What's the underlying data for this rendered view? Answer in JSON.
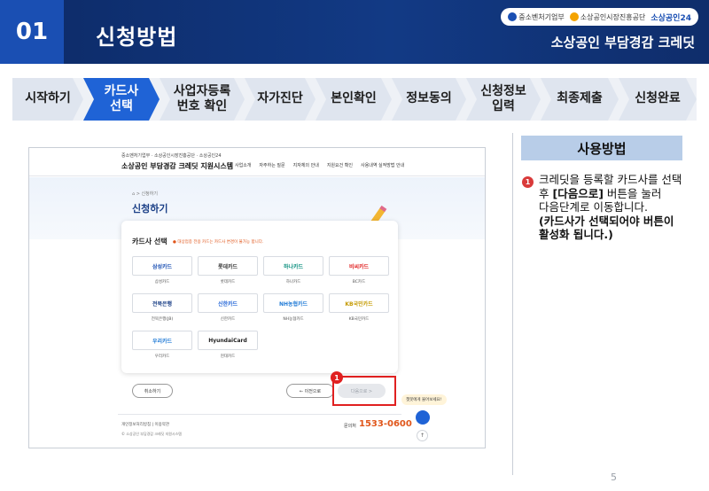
{
  "header": {
    "number": "01",
    "title": "신청방법",
    "subtitle": "소상공인 부담경감 크레딧",
    "logos": [
      "중소벤처기업부",
      "소상공인시장진흥공단",
      "소상공인24"
    ]
  },
  "steps": [
    {
      "label": "시작하기",
      "active": false
    },
    {
      "label": "카드사 선택",
      "active": true
    },
    {
      "label": "사업자등록 번호 확인",
      "active": false
    },
    {
      "label": "자가진단",
      "active": false
    },
    {
      "label": "본인확인",
      "active": false
    },
    {
      "label": "정보동의",
      "active": false
    },
    {
      "label": "신청정보 입력",
      "active": false
    },
    {
      "label": "최종제출",
      "active": false
    },
    {
      "label": "신청완료",
      "active": false
    }
  ],
  "screenshot": {
    "site_logos": "중소벤처기업부 · 소상공인시장진흥공단 · 소상공인24",
    "site_name": "소상공인 부담경감 크레딧 지원시스템",
    "nav": [
      "사업소개",
      "자주하는 질문",
      "지자체의 안내",
      "지원요건 확인",
      "사용내역 실적방법 안내"
    ],
    "breadcrumb": "⌂ > 신청하기",
    "page_title": "신청하기",
    "card_title": "카드사 선택",
    "card_note": "● 대상업종 전용 카드는 카드사 변경이 불가능 합니다.",
    "cards": [
      {
        "name": "삼성카드",
        "caption": "삼성카드",
        "color": "#1a4fb3"
      },
      {
        "name": "롯데카드",
        "caption": "롯데카드",
        "color": "#333333"
      },
      {
        "name": "하나카드",
        "caption": "하나카드",
        "color": "#0a8f7e"
      },
      {
        "name": "비씨카드",
        "caption": "BC카드",
        "color": "#e02020"
      },
      {
        "name": "전북은행",
        "caption": "전북은행(JB)",
        "color": "#1a3f86"
      },
      {
        "name": "신한카드",
        "caption": "신한카드",
        "color": "#1f63d6"
      },
      {
        "name": "NH농협카드",
        "caption": "NH농협카드",
        "color": "#1f7ad6"
      },
      {
        "name": "KB국민카드",
        "caption": "KB국민카드",
        "color": "#c49a00"
      },
      {
        "name": "우리카드",
        "caption": "우리카드",
        "color": "#1f7ad6"
      },
      {
        "name": "HyundaiCard",
        "caption": "현대카드",
        "color": "#222222"
      }
    ],
    "cancel_label": "취소하기",
    "prev_label": "← 이전으로",
    "next_label": "다음으로 >",
    "highlight_number": "1",
    "footer_links": "개인정보처리방침 | 이용약관",
    "footer_copy": "© 소상공인 부담경감 크레딧 지원시스템",
    "call_label": "문의처",
    "call_number": "1533-0600",
    "chat_bubble": "챗봇에게 물어보세요!",
    "top_label": "↑"
  },
  "usage": {
    "heading": "사용방법",
    "number": "1",
    "text_plain": "크레딧을 등록할 카드사를 선택 후 ",
    "text_bold1": "[다음으로]",
    "text_plain2": " 버튼을 눌러 다음단계로 이동합니다.",
    "text_bold2": "(카드사가 선택되어야 버튼이 활성화 됩니다.)"
  },
  "page_number": "5",
  "colors": {
    "header_bg": "#0f2d6b",
    "accent": "#1f63d6",
    "highlight": "#e02020",
    "call_number": "#e0561b"
  }
}
